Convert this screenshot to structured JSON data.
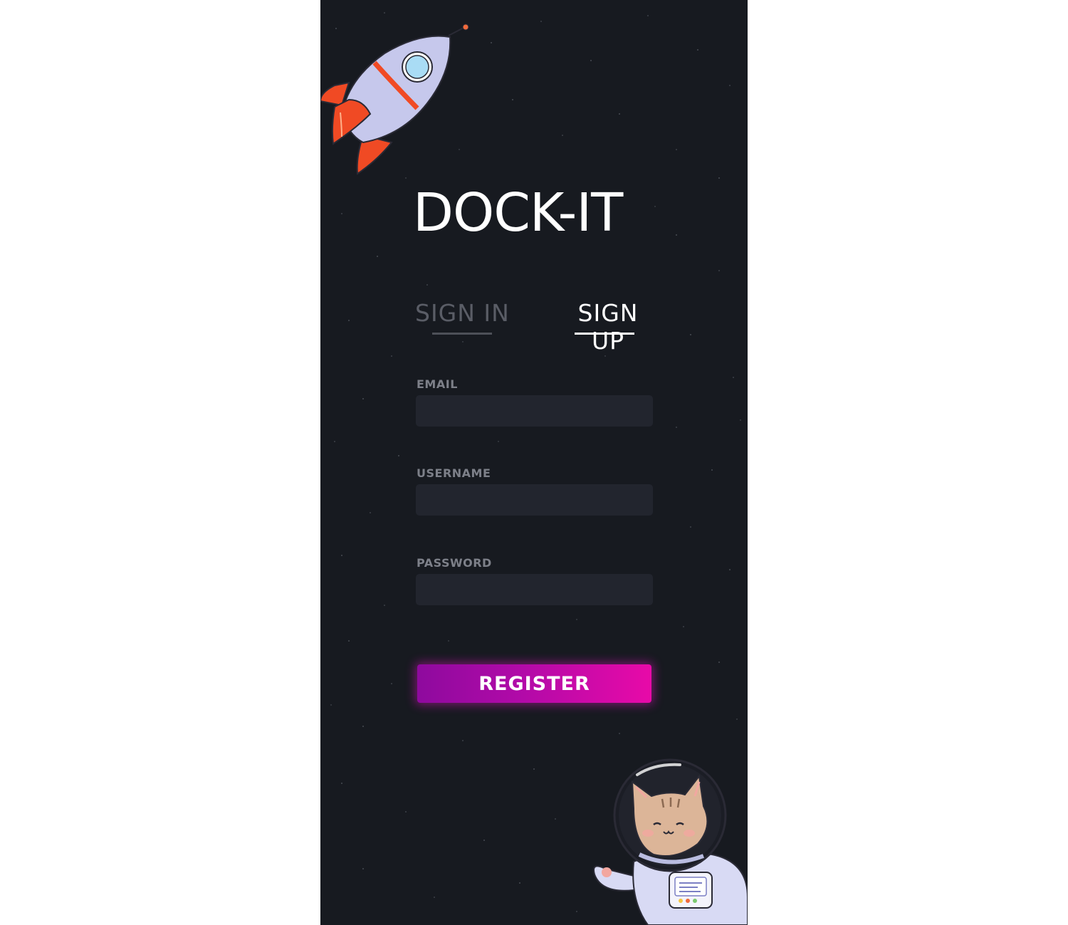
{
  "app": {
    "logo_text": "DOCK-IT"
  },
  "tabs": [
    {
      "label": "SIGN IN",
      "active": false
    },
    {
      "label": "SIGN UP",
      "active": true
    }
  ],
  "form": {
    "email_label": "EMAIL",
    "email_value": "",
    "username_label": "USERNAME",
    "username_value": "",
    "password_label": "PASSWORD",
    "password_value": "",
    "submit_label": "REGISTER"
  },
  "illustrations": {
    "top_left": "rocket-icon",
    "bottom_right": "astronaut-cat-icon"
  },
  "colors": {
    "background": "#171a20",
    "input_background": "#22252e",
    "label": "#7d8089",
    "tab_inactive": "#5a5d66",
    "tab_active": "#ffffff",
    "button_gradient_start": "#8e0a9e",
    "button_gradient_end": "#e80aa8"
  }
}
